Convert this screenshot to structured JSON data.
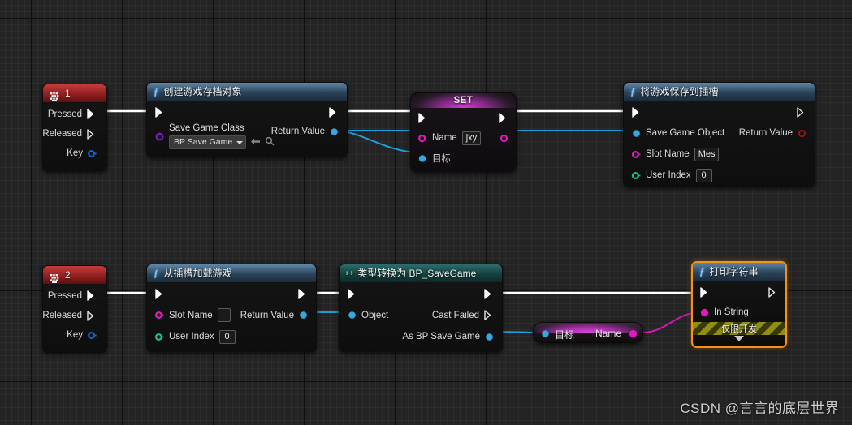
{
  "watermark": "CSDN @言言的底层世界",
  "colors": {
    "exec_white": "#ffffff",
    "object_blue": "#35a7e0",
    "name_magenta": "#e319c0",
    "class_purple": "#7b18c8",
    "int_green": "#20c07a",
    "bool_red": "#8a1616",
    "selection_orange": "#f0921e",
    "dev_yellow": "#8f8f17"
  },
  "nodes": {
    "key1": {
      "title": "1",
      "icon": "keyboard-icon",
      "pins": [
        {
          "label": "Pressed",
          "type": "exec",
          "filled": true
        },
        {
          "label": "Released",
          "type": "exec",
          "filled": false
        },
        {
          "label": "Key",
          "type": "struct",
          "filled": false
        }
      ]
    },
    "create_save": {
      "title": "创建游戏存档对象",
      "icon": "function-icon",
      "in_label": "Save Game Class",
      "in_value": "BP Save Game",
      "out_label": "Return Value",
      "browse_icon": "back-arrow-icon",
      "search_icon": "magnifier-icon"
    },
    "set_node": {
      "title": "SET",
      "pins": [
        {
          "label": "Name",
          "value": "jxy"
        },
        {
          "label": "目标",
          "value": ""
        }
      ]
    },
    "save_to_slot": {
      "title": "将游戏保存到插槽",
      "icon": "function-icon",
      "inputs": [
        {
          "label": "Save Game Object",
          "value": ""
        },
        {
          "label": "Slot Name",
          "value": "Mes"
        },
        {
          "label": "User Index",
          "value": "0"
        }
      ],
      "output": {
        "label": "Return Value"
      }
    },
    "key2": {
      "title": "2",
      "icon": "keyboard-icon",
      "pins": [
        {
          "label": "Pressed",
          "type": "exec",
          "filled": true
        },
        {
          "label": "Released",
          "type": "exec",
          "filled": false
        },
        {
          "label": "Key",
          "type": "struct",
          "filled": false
        }
      ]
    },
    "load_from_slot": {
      "title": "从插槽加载游戏",
      "icon": "function-icon",
      "inputs": [
        {
          "label": "Slot Name",
          "value": ""
        },
        {
          "label": "User Index",
          "value": "0"
        }
      ],
      "output": {
        "label": "Return Value"
      }
    },
    "cast_node": {
      "title": "类型转换为 BP_SaveGame",
      "icon": "cast-icon",
      "input": {
        "label": "Object"
      },
      "outputs": [
        {
          "label": "Cast Failed"
        },
        {
          "label": "As BP Save Game"
        }
      ]
    },
    "get_name": {
      "target_label": "目标",
      "name_label": "Name"
    },
    "print_string": {
      "title": "打印字符串",
      "icon": "function-icon",
      "input": {
        "label": "In String"
      },
      "dev_note": "仅限开发",
      "expand_icon": "chevron-down-icon",
      "selected": true
    }
  }
}
